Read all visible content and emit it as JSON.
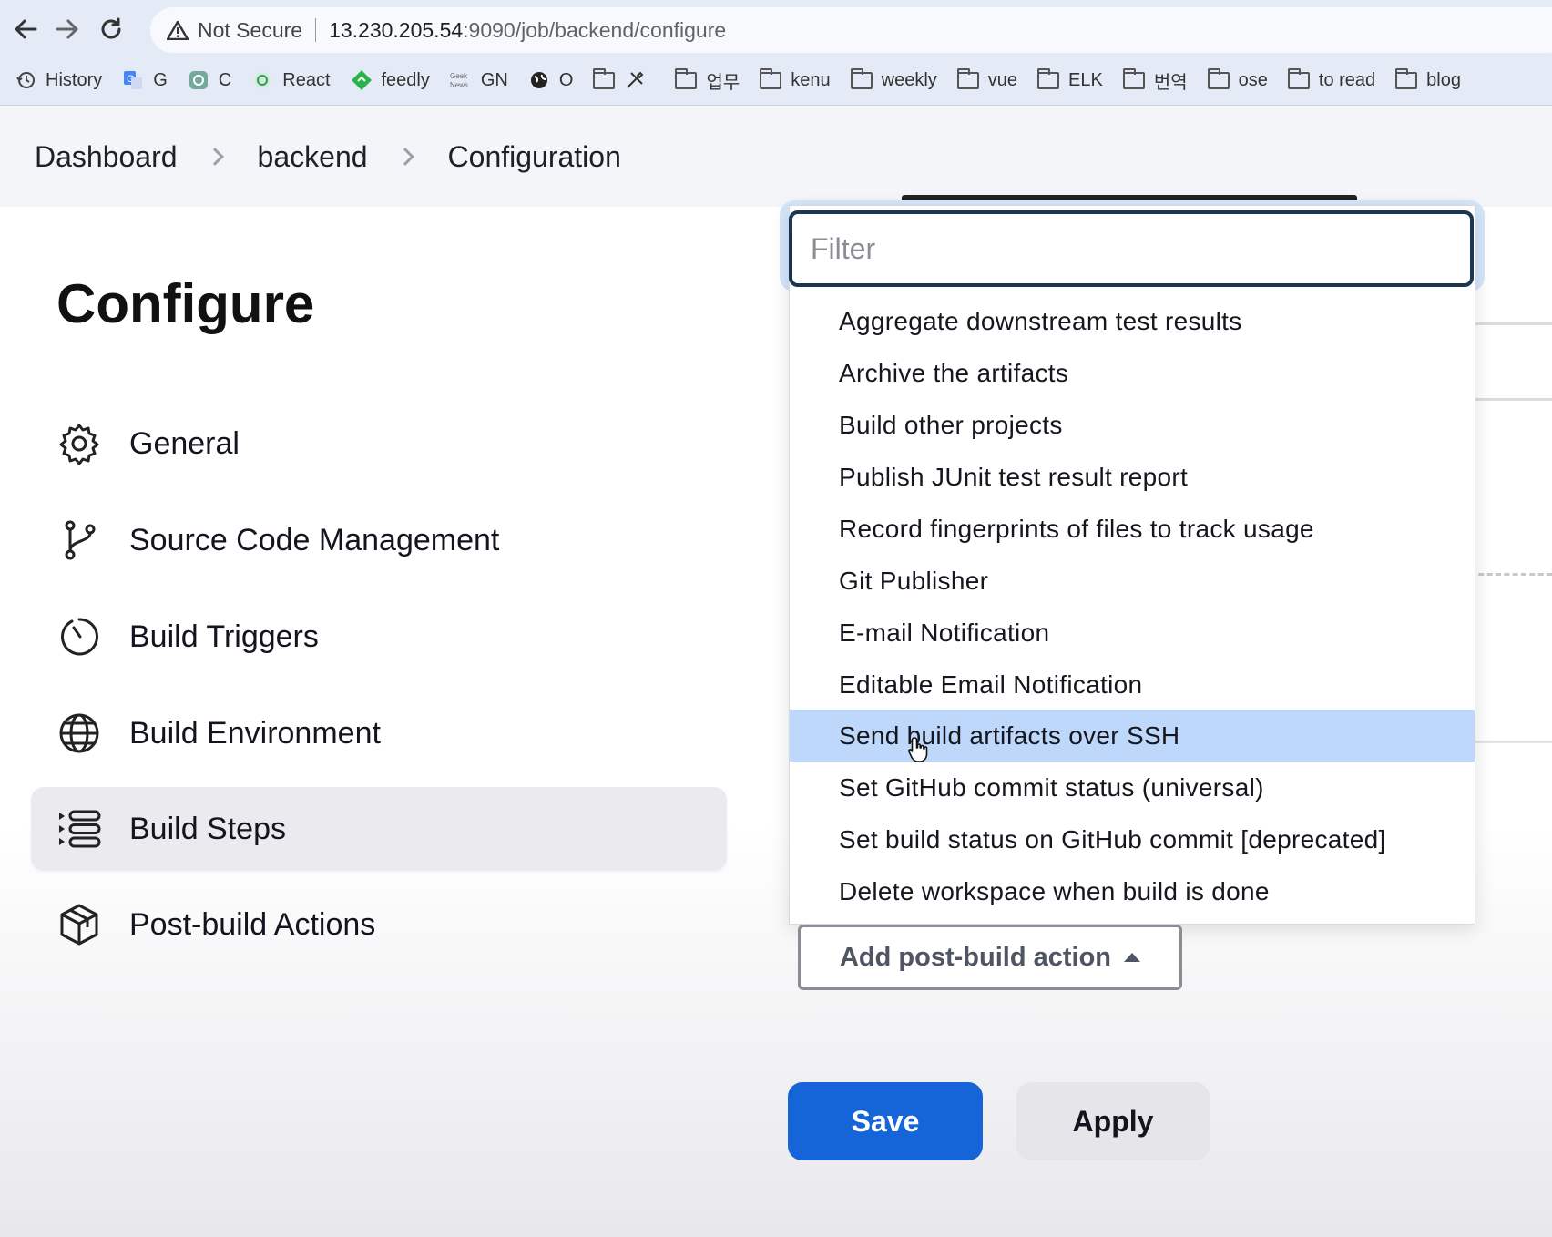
{
  "browser": {
    "security_label": "Not Secure",
    "url_host": "13.230.205.54",
    "url_path": ":9090/job/backend/configure",
    "bookmarks": [
      {
        "label": "History",
        "icon": "history-icon"
      },
      {
        "label": "G",
        "icon": "translate-icon"
      },
      {
        "label": "C",
        "icon": "chatgpt-icon"
      },
      {
        "label": "React",
        "icon": "react-icon"
      },
      {
        "label": "feedly",
        "icon": "feedly-icon"
      },
      {
        "label": "GN",
        "icon": "geeknews-icon"
      },
      {
        "label": "O",
        "icon": "globe-icon"
      },
      {
        "label": "",
        "icon": "folder-icon"
      },
      {
        "label": "업무",
        "icon": "folder-icon"
      },
      {
        "label": "kenu",
        "icon": "folder-icon"
      },
      {
        "label": "weekly",
        "icon": "folder-icon"
      },
      {
        "label": "vue",
        "icon": "folder-icon"
      },
      {
        "label": "ELK",
        "icon": "folder-icon"
      },
      {
        "label": "번역",
        "icon": "folder-icon"
      },
      {
        "label": "ose",
        "icon": "folder-icon"
      },
      {
        "label": "to read",
        "icon": "folder-icon"
      },
      {
        "label": "blog",
        "icon": "folder-icon"
      }
    ]
  },
  "breadcrumb": {
    "items": [
      "Dashboard",
      "backend",
      "Configuration"
    ]
  },
  "page": {
    "title": "Configure"
  },
  "sidebar": {
    "items": [
      {
        "label": "General",
        "icon": "gear-icon"
      },
      {
        "label": "Source Code Management",
        "icon": "branch-icon"
      },
      {
        "label": "Build Triggers",
        "icon": "clock-icon"
      },
      {
        "label": "Build Environment",
        "icon": "globe-icon"
      },
      {
        "label": "Build Steps",
        "icon": "list-icon",
        "active": true
      },
      {
        "label": "Post-build Actions",
        "icon": "package-icon"
      }
    ]
  },
  "dropdown": {
    "filter_placeholder": "Filter",
    "options": [
      "Aggregate downstream test results",
      "Archive the artifacts",
      "Build other projects",
      "Publish JUnit test result report",
      "Record fingerprints of files to track usage",
      "Git Publisher",
      "E-mail Notification",
      "Editable Email Notification",
      "Send build artifacts over SSH",
      "Set GitHub commit status (universal)",
      "Set build status on GitHub commit [deprecated]",
      "Delete workspace when build is done"
    ],
    "highlighted_index": 8,
    "highlight_color": "#bdd8fb"
  },
  "actions": {
    "add_post_build_label": "Add post-build action",
    "save_label": "Save",
    "apply_label": "Apply",
    "save_color": "#1565d8"
  }
}
